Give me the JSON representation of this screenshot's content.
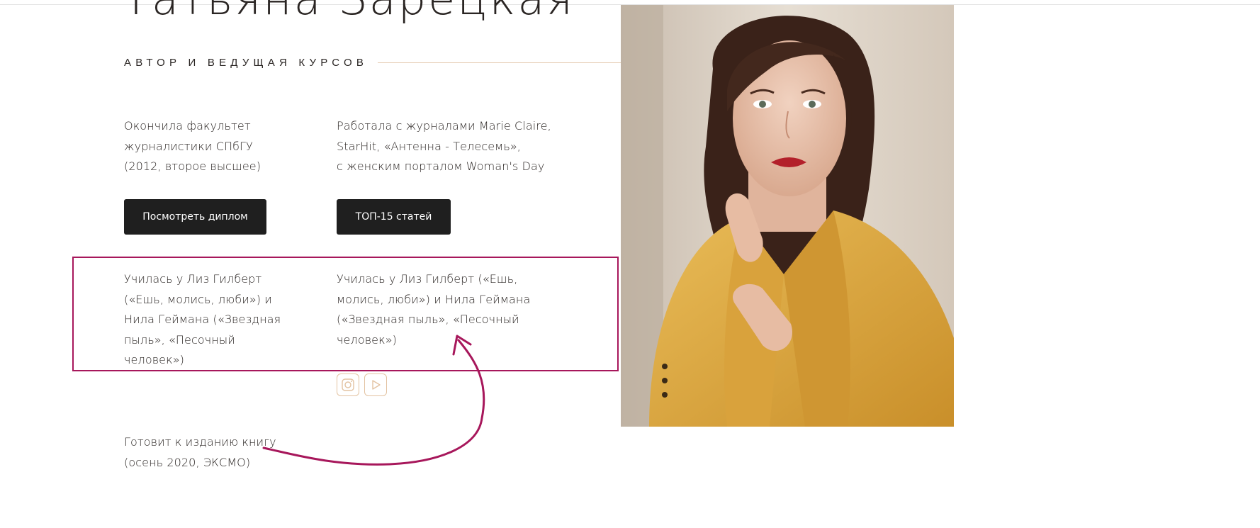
{
  "author": {
    "name": "Татьяна Зарецкая",
    "subtitle": "АВТОР И ВЕДУЩАЯ КУРСОВ"
  },
  "facts": [
    {
      "lines": [
        "Окончила факультет",
        "журналистики СПбГУ",
        "(2012, второе высшее)"
      ]
    },
    {
      "lines": [
        "Работала с журналами Marie Claire,",
        "StarHit, «Антенна - Телесемь»,",
        "с женским порталом Woman's Day"
      ]
    },
    {
      "lines": [
        "Училась у Лиз Гилберт",
        "(«Ешь, молись, люби») и",
        "Нила Геймана («Звездная",
        "пыль», «Песочный",
        "человек»)"
      ]
    },
    {
      "lines": [
        "Училась у Лиз Гилберт («Ешь,",
        "молись, люби») и Нила Геймана",
        "(«Звездная пыль», «Песочный",
        "человек»)"
      ]
    },
    {
      "lines": [
        "Готовит к изданию книгу",
        "(осень 2020, ЭКСМО)"
      ]
    }
  ],
  "buttons": {
    "diploma": "Посмотреть диплом",
    "top_articles": "ТОП-15 статей"
  },
  "social": [
    {
      "icon": "instagram-icon"
    },
    {
      "icon": "youtube-icon"
    }
  ],
  "colors": {
    "accent_gold": "#e3c3a2",
    "annotation_magenta": "#a7175b",
    "button_dark": "#1f1f1f",
    "jacket_yellow": "#dba53e"
  }
}
